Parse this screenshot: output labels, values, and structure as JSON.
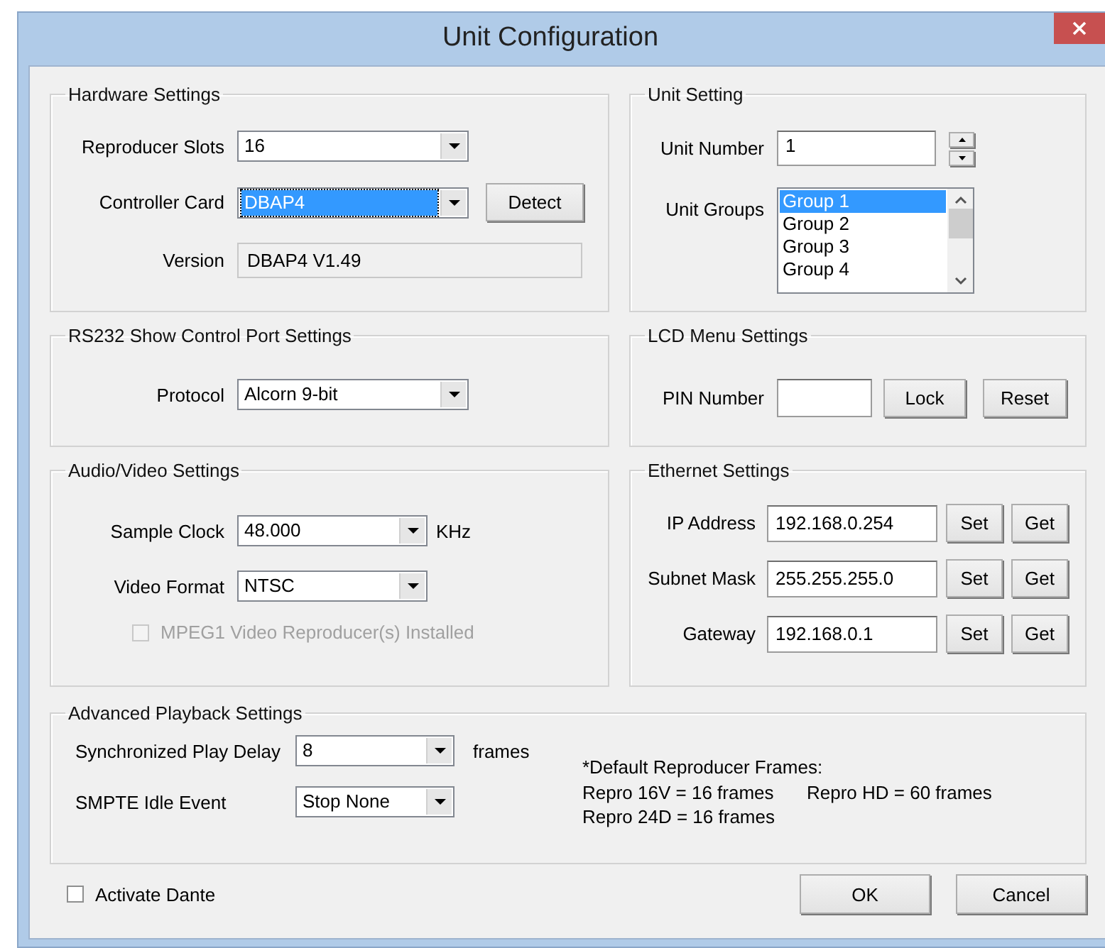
{
  "window": {
    "title": "Unit Configuration"
  },
  "hardware_settings": {
    "title": "Hardware Settings",
    "reproducer_slots": {
      "label": "Reproducer Slots",
      "value": "16"
    },
    "controller_card": {
      "label": "Controller Card",
      "value": "DBAP4",
      "focused": true,
      "button": "Detect"
    },
    "version": {
      "label": "Version",
      "value": "DBAP4 V1.49"
    }
  },
  "unit_setting": {
    "title": "Unit Setting",
    "unit_number": {
      "label": "Unit Number",
      "value": "1"
    },
    "unit_groups": {
      "label": "Unit Groups",
      "items": [
        {
          "label": "Group 1",
          "selected": true
        },
        {
          "label": "Group 2",
          "selected": false
        },
        {
          "label": "Group 3",
          "selected": false
        },
        {
          "label": "Group 4",
          "selected": false
        }
      ]
    }
  },
  "rs232": {
    "title": "RS232 Show Control Port Settings",
    "protocol": {
      "label": "Protocol",
      "value": "Alcorn 9-bit"
    }
  },
  "lcd_menu": {
    "title": "LCD Menu Settings",
    "pin_number": {
      "label": "PIN Number"
    },
    "buttons": [
      "Lock",
      "Reset"
    ]
  },
  "audio_video": {
    "title": "Audio/Video Settings",
    "sample_clock": {
      "label": "Sample Clock",
      "value": "48.000",
      "unit": "KHz"
    },
    "video_format": {
      "label": "Video Format",
      "value": "NTSC"
    },
    "mpeg1": {
      "label": "MPEG1 Video Reproducer(s) Installed",
      "checked": false,
      "disabled": true
    }
  },
  "ethernet": {
    "title": "Ethernet Settings",
    "rows": [
      {
        "label": "IP Address",
        "value": "192.168.0.254",
        "buttons": [
          "Set",
          "Get"
        ]
      },
      {
        "label": "Subnet Mask",
        "value": "255.255.255.0",
        "buttons": [
          "Set",
          "Get"
        ]
      },
      {
        "label": "Gateway",
        "value": "192.168.0.1",
        "buttons": [
          "Set",
          "Get"
        ]
      }
    ]
  },
  "advanced_playback": {
    "title": "Advanced Playback Settings",
    "sync_play_delay": {
      "label": "Synchronized Play Delay",
      "value": "8",
      "unit": "frames"
    },
    "smpte_idle_event": {
      "label": "SMPTE Idle Event",
      "value": "Stop None"
    },
    "notes": {
      "heading": "*Default Reproducer Frames:",
      "items": [
        "Repro 16V = 16 frames",
        "Repro HD = 60 frames",
        "Repro 24D = 16 frames"
      ]
    }
  },
  "activate_dante": {
    "label": "Activate Dante",
    "checked": false
  },
  "buttons": [
    "OK",
    "Cancel"
  ]
}
